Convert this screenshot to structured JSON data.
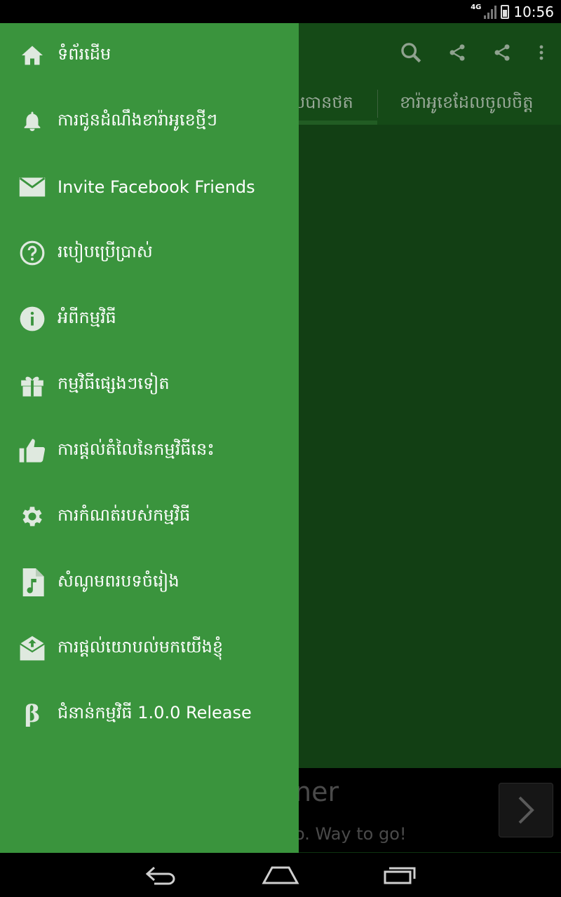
{
  "status_bar": {
    "network": "4G",
    "time": "10:56"
  },
  "background_app": {
    "toolbar_icons": [
      "search-icon",
      "share-icon",
      "share-icon",
      "more-vert-icon"
    ],
    "tabs": [
      {
        "label": "បបានថត"
      },
      {
        "label": "ខារ៉ាអូខេដែលចូលចិត្ត"
      }
    ],
    "banner": {
      "title": "ner",
      "subtitle": "o. Way to go!"
    }
  },
  "drawer": {
    "items": [
      {
        "icon": "home-icon",
        "label": "ទំព័រដើម"
      },
      {
        "icon": "bell-icon",
        "label": "ការជូនដំណឹងខារ៉ាអូខេថ្មីៗ"
      },
      {
        "icon": "mail-icon",
        "label": "Invite Facebook Friends"
      },
      {
        "icon": "help-icon",
        "label": "របៀបប្រើប្រាស់"
      },
      {
        "icon": "info-icon",
        "label": "អំពីកម្មវិធី"
      },
      {
        "icon": "gift-icon",
        "label": "កម្មវិធីផ្សេងៗទៀត"
      },
      {
        "icon": "thumbs-up-icon",
        "label": "ការផ្តល់តំលៃនៃកម្មវិធីនេះ"
      },
      {
        "icon": "settings-icon",
        "label": "ការកំណត់របស់កម្មវិធី"
      },
      {
        "icon": "music-file-icon",
        "label": "សំណូមពរបទចំរៀង"
      },
      {
        "icon": "feedback-mail-icon",
        "label": "ការផ្តល់យោបល់មកយើងខ្ញុំ"
      },
      {
        "icon": "beta-icon",
        "label": "ជំនាន់កម្មវិធី 1.0.0 Release"
      }
    ]
  },
  "colors": {
    "drawer_bg": "#3a943d",
    "app_bar": "#154a17",
    "content_bg": "#123f14"
  }
}
